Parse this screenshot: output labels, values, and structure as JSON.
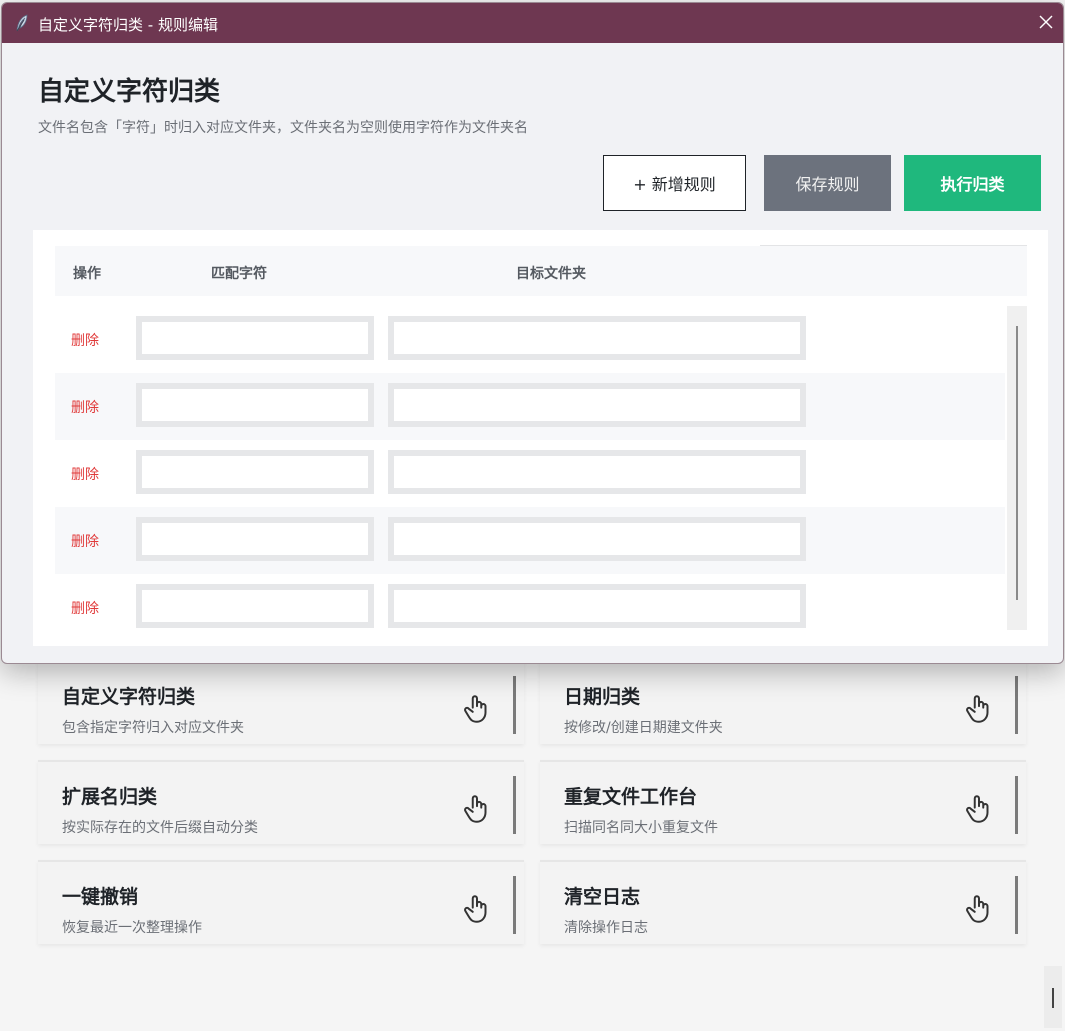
{
  "dialog": {
    "window_title": "自定义字符归类 - 规则编辑",
    "heading": "自定义字符归类",
    "description": "文件名包含「字符」时归入对应文件夹，文件夹名为空则使用字符作为文件夹名",
    "buttons": {
      "add": "+ 新增规则",
      "save": "保存规则",
      "run": "执行归类"
    },
    "table": {
      "headers": {
        "action": "操作",
        "match": "匹配字符",
        "target": "目标文件夹"
      },
      "rows": [
        {
          "delete": "删除",
          "match": "",
          "target": ""
        },
        {
          "delete": "删除",
          "match": "",
          "target": ""
        },
        {
          "delete": "删除",
          "match": "",
          "target": ""
        },
        {
          "delete": "删除",
          "match": "",
          "target": ""
        },
        {
          "delete": "删除",
          "match": "",
          "target": ""
        }
      ]
    }
  },
  "cards": [
    {
      "title": "自定义字符归类",
      "sub": "包含指定字符归入对应文件夹"
    },
    {
      "title": "日期归类",
      "sub": "按修改/创建日期建文件夹"
    },
    {
      "title": "扩展名归类",
      "sub": "按实际存在的文件后缀自动分类"
    },
    {
      "title": "重复文件工作台",
      "sub": "扫描同名同大小重复文件"
    },
    {
      "title": "一键撤销",
      "sub": "恢复最近一次整理操作"
    },
    {
      "title": "清空日志",
      "sub": "清除操作日志"
    }
  ],
  "colors": {
    "titlebar": "#6e3751",
    "run_button": "#1fb87d",
    "save_button": "#6c727d",
    "delete_text": "#e03a3a"
  },
  "icons": {
    "app": "feather-icon",
    "close": "close-icon",
    "card_action": "hand-pointer-icon"
  }
}
